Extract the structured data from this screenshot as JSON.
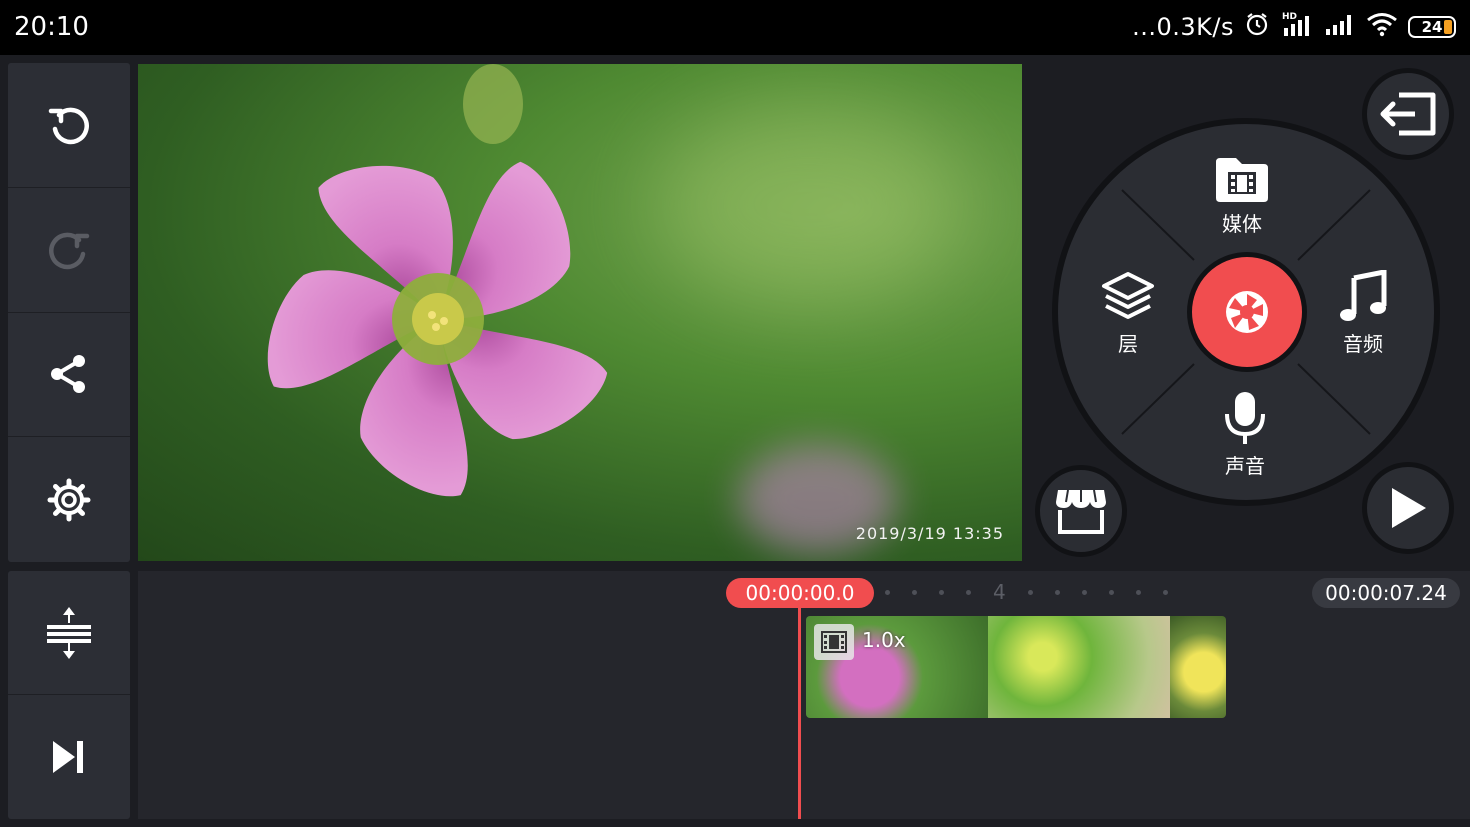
{
  "status_bar": {
    "time": "20:10",
    "net_speed": "...0.3K/s",
    "battery": "24",
    "icons": [
      "alarm-icon",
      "hd-signal-icon",
      "signal-icon",
      "wifi-icon",
      "battery-icon"
    ]
  },
  "left_tools": [
    "undo-icon",
    "redo-icon",
    "share-icon",
    "settings-icon"
  ],
  "bottom_tools": [
    "track-expand-icon",
    "skip-to-end-icon"
  ],
  "preview": {
    "timestamp": "2019/3/19  13:35"
  },
  "wheel": {
    "media_label": "媒体",
    "layer_label": "层",
    "audio_label": "音频",
    "voice_label": "声音",
    "center_icon": "camera-shutter-icon"
  },
  "timeline": {
    "current_time": "00:00:00.0",
    "total_time": "00:00:07.24",
    "ruler_number": "4",
    "clip_speed": "1.0x"
  },
  "colors": {
    "accent": "#f14d4f",
    "panel": "#2c2e35",
    "background": "#1c1d22"
  }
}
